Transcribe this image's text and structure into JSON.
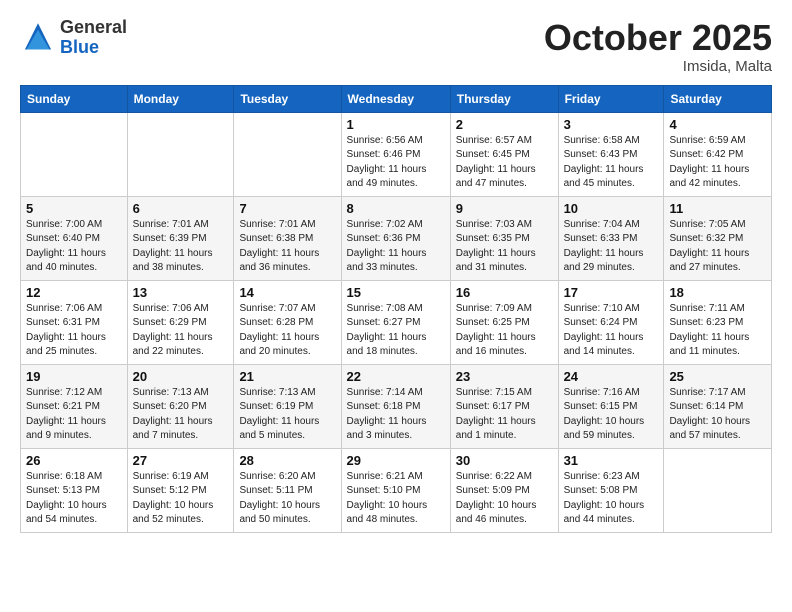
{
  "logo": {
    "general": "General",
    "blue": "Blue"
  },
  "title": "October 2025",
  "subtitle": "Imsida, Malta",
  "days_of_week": [
    "Sunday",
    "Monday",
    "Tuesday",
    "Wednesday",
    "Thursday",
    "Friday",
    "Saturday"
  ],
  "weeks": [
    [
      {
        "day": "",
        "info": ""
      },
      {
        "day": "",
        "info": ""
      },
      {
        "day": "",
        "info": ""
      },
      {
        "day": "1",
        "info": "Sunrise: 6:56 AM\nSunset: 6:46 PM\nDaylight: 11 hours\nand 49 minutes."
      },
      {
        "day": "2",
        "info": "Sunrise: 6:57 AM\nSunset: 6:45 PM\nDaylight: 11 hours\nand 47 minutes."
      },
      {
        "day": "3",
        "info": "Sunrise: 6:58 AM\nSunset: 6:43 PM\nDaylight: 11 hours\nand 45 minutes."
      },
      {
        "day": "4",
        "info": "Sunrise: 6:59 AM\nSunset: 6:42 PM\nDaylight: 11 hours\nand 42 minutes."
      }
    ],
    [
      {
        "day": "5",
        "info": "Sunrise: 7:00 AM\nSunset: 6:40 PM\nDaylight: 11 hours\nand 40 minutes."
      },
      {
        "day": "6",
        "info": "Sunrise: 7:01 AM\nSunset: 6:39 PM\nDaylight: 11 hours\nand 38 minutes."
      },
      {
        "day": "7",
        "info": "Sunrise: 7:01 AM\nSunset: 6:38 PM\nDaylight: 11 hours\nand 36 minutes."
      },
      {
        "day": "8",
        "info": "Sunrise: 7:02 AM\nSunset: 6:36 PM\nDaylight: 11 hours\nand 33 minutes."
      },
      {
        "day": "9",
        "info": "Sunrise: 7:03 AM\nSunset: 6:35 PM\nDaylight: 11 hours\nand 31 minutes."
      },
      {
        "day": "10",
        "info": "Sunrise: 7:04 AM\nSunset: 6:33 PM\nDaylight: 11 hours\nand 29 minutes."
      },
      {
        "day": "11",
        "info": "Sunrise: 7:05 AM\nSunset: 6:32 PM\nDaylight: 11 hours\nand 27 minutes."
      }
    ],
    [
      {
        "day": "12",
        "info": "Sunrise: 7:06 AM\nSunset: 6:31 PM\nDaylight: 11 hours\nand 25 minutes."
      },
      {
        "day": "13",
        "info": "Sunrise: 7:06 AM\nSunset: 6:29 PM\nDaylight: 11 hours\nand 22 minutes."
      },
      {
        "day": "14",
        "info": "Sunrise: 7:07 AM\nSunset: 6:28 PM\nDaylight: 11 hours\nand 20 minutes."
      },
      {
        "day": "15",
        "info": "Sunrise: 7:08 AM\nSunset: 6:27 PM\nDaylight: 11 hours\nand 18 minutes."
      },
      {
        "day": "16",
        "info": "Sunrise: 7:09 AM\nSunset: 6:25 PM\nDaylight: 11 hours\nand 16 minutes."
      },
      {
        "day": "17",
        "info": "Sunrise: 7:10 AM\nSunset: 6:24 PM\nDaylight: 11 hours\nand 14 minutes."
      },
      {
        "day": "18",
        "info": "Sunrise: 7:11 AM\nSunset: 6:23 PM\nDaylight: 11 hours\nand 11 minutes."
      }
    ],
    [
      {
        "day": "19",
        "info": "Sunrise: 7:12 AM\nSunset: 6:21 PM\nDaylight: 11 hours\nand 9 minutes."
      },
      {
        "day": "20",
        "info": "Sunrise: 7:13 AM\nSunset: 6:20 PM\nDaylight: 11 hours\nand 7 minutes."
      },
      {
        "day": "21",
        "info": "Sunrise: 7:13 AM\nSunset: 6:19 PM\nDaylight: 11 hours\nand 5 minutes."
      },
      {
        "day": "22",
        "info": "Sunrise: 7:14 AM\nSunset: 6:18 PM\nDaylight: 11 hours\nand 3 minutes."
      },
      {
        "day": "23",
        "info": "Sunrise: 7:15 AM\nSunset: 6:17 PM\nDaylight: 11 hours\nand 1 minute."
      },
      {
        "day": "24",
        "info": "Sunrise: 7:16 AM\nSunset: 6:15 PM\nDaylight: 10 hours\nand 59 minutes."
      },
      {
        "day": "25",
        "info": "Sunrise: 7:17 AM\nSunset: 6:14 PM\nDaylight: 10 hours\nand 57 minutes."
      }
    ],
    [
      {
        "day": "26",
        "info": "Sunrise: 6:18 AM\nSunset: 5:13 PM\nDaylight: 10 hours\nand 54 minutes."
      },
      {
        "day": "27",
        "info": "Sunrise: 6:19 AM\nSunset: 5:12 PM\nDaylight: 10 hours\nand 52 minutes."
      },
      {
        "day": "28",
        "info": "Sunrise: 6:20 AM\nSunset: 5:11 PM\nDaylight: 10 hours\nand 50 minutes."
      },
      {
        "day": "29",
        "info": "Sunrise: 6:21 AM\nSunset: 5:10 PM\nDaylight: 10 hours\nand 48 minutes."
      },
      {
        "day": "30",
        "info": "Sunrise: 6:22 AM\nSunset: 5:09 PM\nDaylight: 10 hours\nand 46 minutes."
      },
      {
        "day": "31",
        "info": "Sunrise: 6:23 AM\nSunset: 5:08 PM\nDaylight: 10 hours\nand 44 minutes."
      },
      {
        "day": "",
        "info": ""
      }
    ]
  ]
}
